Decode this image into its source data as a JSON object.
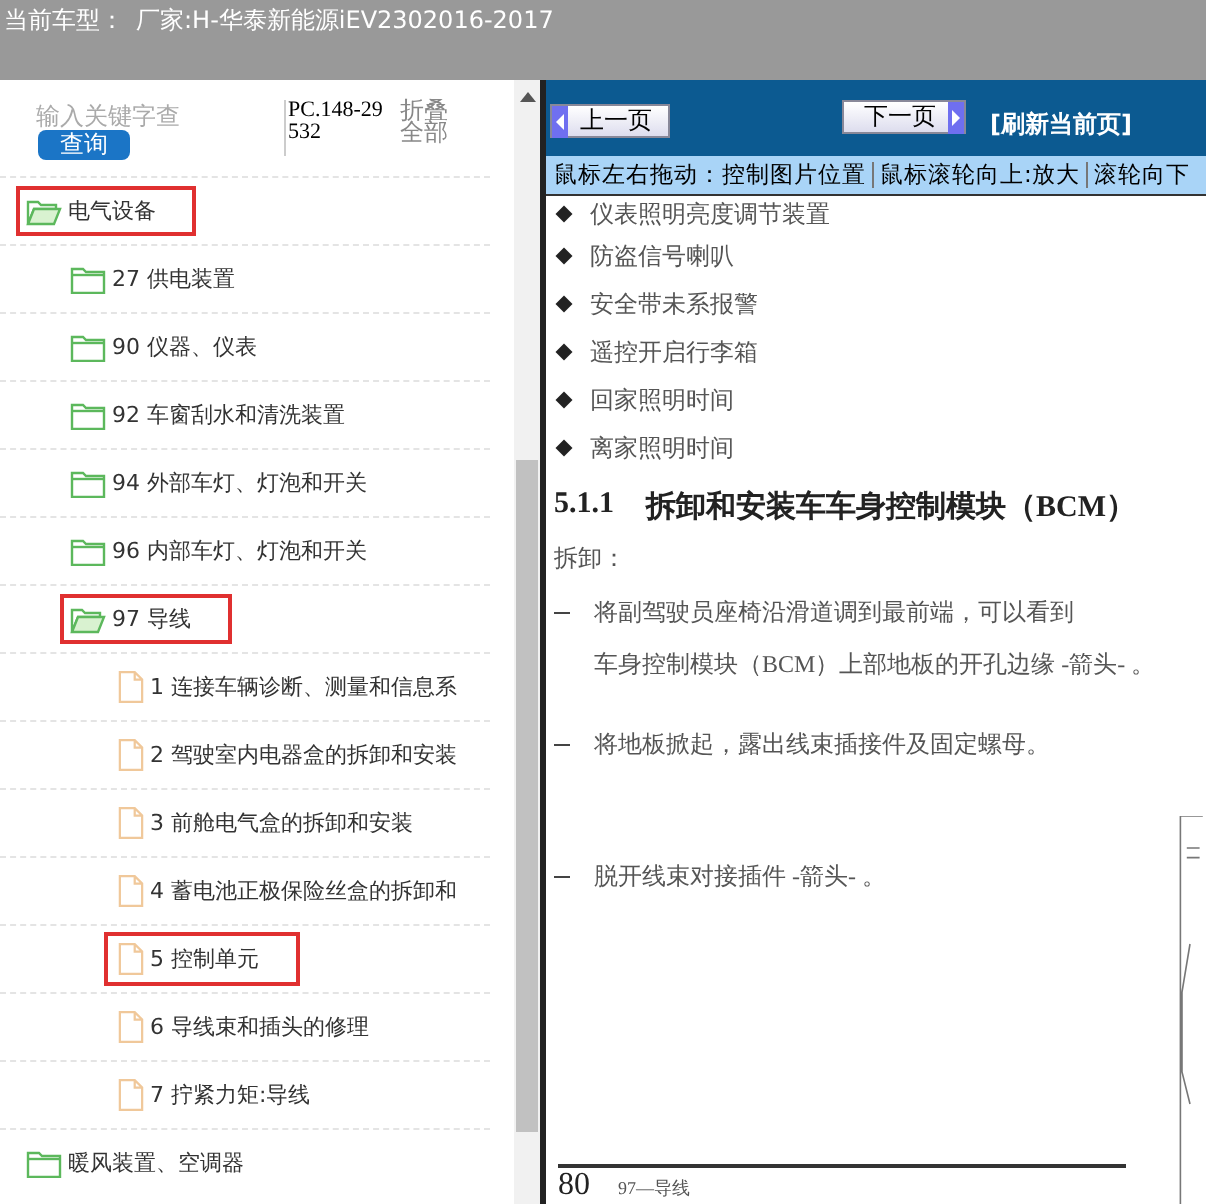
{
  "header": {
    "label": "当前车型：",
    "vehicle": "厂家:H-华泰新能源iEV2302016-2017"
  },
  "search": {
    "placeholder": "输入关键字查",
    "button": "查询",
    "code": "PC.148-29532",
    "collapse": "折叠全部"
  },
  "tree": [
    {
      "label": "电气设备",
      "kind": "folder",
      "expanded": true,
      "highlighted": true,
      "children": [
        {
          "label": "27 供电装置",
          "kind": "folder",
          "expanded": false,
          "highlighted": false
        },
        {
          "label": "90 仪器、仪表",
          "kind": "folder",
          "expanded": false,
          "highlighted": false
        },
        {
          "label": "92 车窗刮水和清洗装置",
          "kind": "folder",
          "expanded": false,
          "highlighted": false
        },
        {
          "label": "94 外部车灯、灯泡和开关",
          "kind": "folder",
          "expanded": false,
          "highlighted": false
        },
        {
          "label": "96 内部车灯、灯泡和开关",
          "kind": "folder",
          "expanded": false,
          "highlighted": false
        },
        {
          "label": "97 导线",
          "kind": "folder",
          "expanded": true,
          "highlighted": true,
          "children": [
            {
              "label": "1 连接车辆诊断、测量和信息系",
              "kind": "file",
              "highlighted": false
            },
            {
              "label": "2 驾驶室内电器盒的拆卸和安装",
              "kind": "file",
              "highlighted": false
            },
            {
              "label": "3 前舱电气盒的拆卸和安装",
              "kind": "file",
              "highlighted": false
            },
            {
              "label": "4 蓄电池正极保险丝盒的拆卸和",
              "kind": "file",
              "highlighted": false
            },
            {
              "label": "5 控制单元",
              "kind": "file",
              "highlighted": true
            },
            {
              "label": "6 导线束和插头的修理",
              "kind": "file",
              "highlighted": false
            },
            {
              "label": "7 拧紧力矩:导线",
              "kind": "file",
              "highlighted": false
            }
          ]
        }
      ]
    },
    {
      "label": "暖风装置、空调器",
      "kind": "folder",
      "expanded": false,
      "highlighted": false
    }
  ],
  "toolbar": {
    "prev": "上一页",
    "next": "下一页",
    "refresh": "[刷新当前页]"
  },
  "hints": [
    "鼠标左右拖动：控制图片位置",
    "鼠标滚轮向上:放大",
    "滚轮向下"
  ],
  "document": {
    "bullets": [
      "仪表照明亮度调节装置",
      "防盗信号喇叭",
      "安全带未系报警",
      "遥控开启行李箱",
      "回家照明时间",
      "离家照明时间"
    ],
    "heading_number": "5.1.1",
    "heading": "拆卸和安装车车身控制模块（BCM）",
    "subheading": "拆卸：",
    "steps": [
      {
        "lines": [
          "将副驾驶员座椅沿滑道调到最前端，可以看到",
          "车身控制模块（BCM）上部地板的开孔边缘 -箭头- 。"
        ]
      },
      {
        "lines": [
          "将地板掀起，露出线束插接件及固定螺母。"
        ]
      },
      {
        "lines": [
          "脱开线束对接插件 -箭头- 。"
        ]
      }
    ],
    "page_number": "80",
    "footer": "97—导线"
  }
}
